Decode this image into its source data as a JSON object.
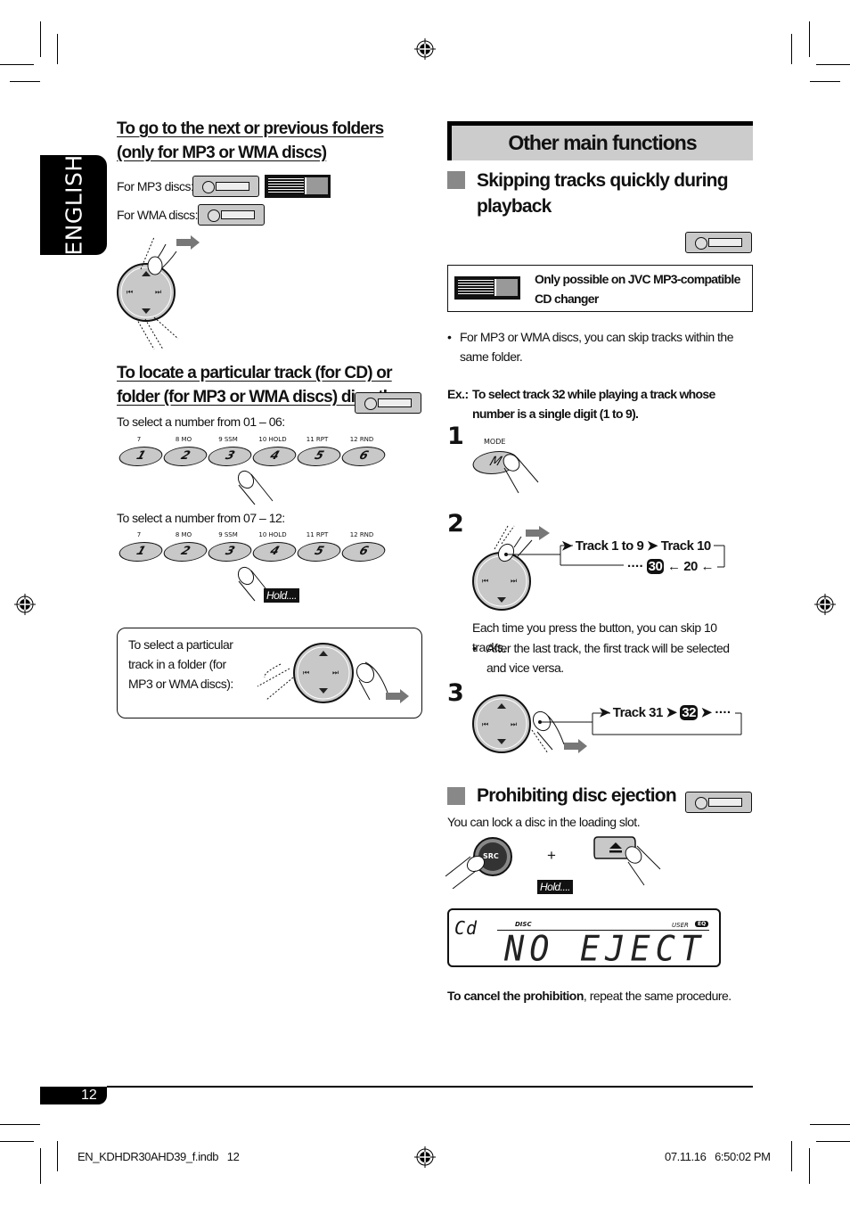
{
  "language_tab": "ENGLISH",
  "left": {
    "folders": {
      "heading": "To go to the next or previous folders (only for MP3 or WMA discs)",
      "mp3_label": "For MP3 discs:",
      "wma_label": "For WMA discs:"
    },
    "locate": {
      "heading": "To locate a particular track (for CD) or folder (for MP3 or WMA discs) directly",
      "range1_label": "To select a number from 01 – 06:",
      "range2_label": "To select a number from 07 – 12:",
      "keys": [
        {
          "top": "7",
          "num": "1"
        },
        {
          "top": "8  MO",
          "num": "2"
        },
        {
          "top": "9  SSM",
          "num": "3"
        },
        {
          "top": "10 HOLD",
          "num": "4"
        },
        {
          "top": "11  RPT",
          "num": "5"
        },
        {
          "top": "12  RND",
          "num": "6"
        }
      ],
      "hold_label": "Hold...."
    },
    "box_text": "To select a particular track in a folder (for MP3 or WMA discs):"
  },
  "right": {
    "section_title": "Other main functions",
    "skipping": {
      "heading": "Skipping tracks quickly during playback",
      "note": "Only possible on JVC MP3-compatible CD changer",
      "bullet": "For MP3 or WMA discs, you can skip tracks within the same folder.",
      "ex_prefix": "Ex.:",
      "ex_text": "To select track 32 while playing a track whose number is a single digit (1 to 9).",
      "step1": {
        "num": "1",
        "button_label": "MODE",
        "button_glyph": "M"
      },
      "step2": {
        "num": "2",
        "flow_a": "Track 1 to 9",
        "flow_b": "Track 10",
        "flow_c": "20",
        "flow_badge": "30",
        "desc": "Each time you press the button, you can skip 10 tracks.",
        "bullet": "After the last track, the first track will be selected and vice versa."
      },
      "step3": {
        "num": "3",
        "flow_a": "Track 31",
        "flow_badge": "32"
      }
    },
    "eject": {
      "heading": "Prohibiting disc ejection",
      "desc": "You can lock a disc in the loading slot.",
      "src_label": "SRC",
      "plus": "+",
      "hold_label": "Hold....",
      "lcd": {
        "left": "Cd",
        "disc": "DISC",
        "user": "USER",
        "eq": "EQ",
        "main": "NO EJECT"
      },
      "cancel_bold": "To cancel the prohibition",
      "cancel_rest": ", repeat the same procedure."
    }
  },
  "footer": {
    "page_number": "12",
    "file": "EN_KDHDR30AHD39_f.indb   12",
    "timestamp": "07.11.16   6:50:02 PM"
  }
}
